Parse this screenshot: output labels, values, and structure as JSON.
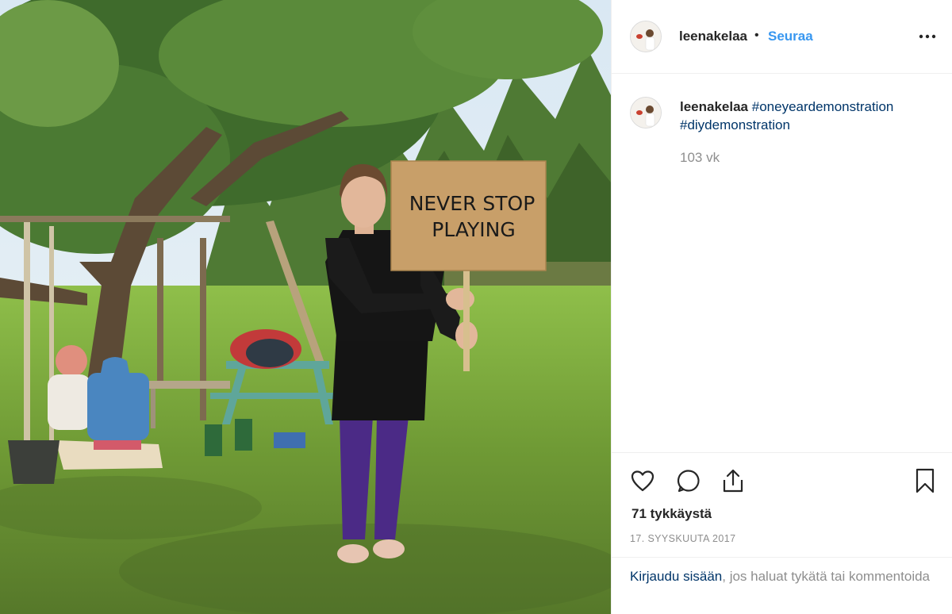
{
  "photo": {
    "sign_line1": "NEVER STOP",
    "sign_line2": "PLAYING"
  },
  "post": {
    "username": "leenakelaa",
    "separator": "•",
    "follow_label": "Seuraa",
    "caption_username": "leenakelaa",
    "hashtag1": "#oneyeardemonstration",
    "hashtag2": "#diydemonstration",
    "time_ago": "103 vk",
    "likes": "71 tykkäystä",
    "date": "17. SYYSKUUTA 2017",
    "login_link": "Kirjaudu sisään",
    "login_text": ", jos haluat tykätä tai kommentoida"
  },
  "icons": {
    "more": "more-options-icon",
    "like": "heart-icon",
    "comment": "comment-bubble-icon",
    "share": "share-upload-icon",
    "save": "bookmark-icon"
  },
  "colors": {
    "accent": "#3897f0",
    "link": "#003569",
    "muted": "#8e8e8e"
  }
}
